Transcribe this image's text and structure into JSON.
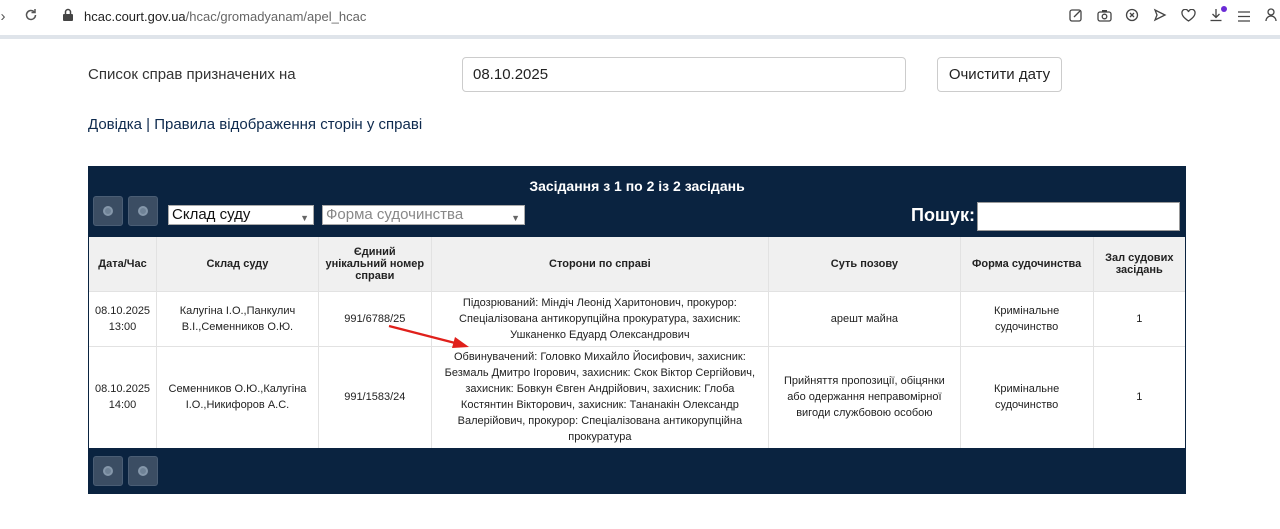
{
  "browser": {
    "url_host": "hcac.court.gov.ua",
    "url_path": "/hcac/gromadyanam/apel_hcac"
  },
  "header": {
    "list_label": "Список справ призначених на",
    "date_value": "08.10.2025",
    "clear_button": "Очистити дату",
    "link_help": "Довідка",
    "link_separator": "|",
    "link_rules": "Правила відображення сторін у справі"
  },
  "panel": {
    "title": "Засідання з 1 по 2 із 2 засідань",
    "select_court": "Склад суду",
    "select_form": "Форма судочинства",
    "search_label": "Пошук:",
    "search_value": ""
  },
  "table": {
    "headers": {
      "date": "Дата/Час",
      "court": "Склад суду",
      "number": "Єдиний унікальний номер справи",
      "parties": "Сторони по справі",
      "essence": "Суть позову",
      "form": "Форма судочинства",
      "hall": "Зал судових засідань"
    },
    "rows": [
      {
        "date": "08.10.2025 13:00",
        "court": "Калугіна І.О.,Панкулич В.І.,Семенников О.Ю.",
        "number": "991/6788/25",
        "parties": "Підозрюваний: Міндіч Леонід Харитонович, прокурор: Спеціалізована антикорупційна прокуратура, захисник: Ушканенко Едуард Олександрович",
        "essence": "арешт майна",
        "form": "Кримінальне судочинство",
        "hall": "1"
      },
      {
        "date": "08.10.2025 14:00",
        "court": "Семенников О.Ю.,Калугіна І.О.,Никифоров А.С.",
        "number": "991/1583/24",
        "parties": "Обвинувачений: Головко Михайло Йосифович, захисник: Безмаль Дмитро Ігорович, захисник: Скок Віктор Сергійович, захисник: Бовкун Євген Андрійович, захисник: Глоба Костянтин Вікторович, захисник: Тананакін Олександр Валерійович, прокурор: Спеціалізована антикорупційна прокуратура",
        "essence": "Прийняття пропозиції, обіцянки або одержання неправомірної вигоди службовою особою",
        "form": "Кримінальне судочинство",
        "hall": "1"
      }
    ]
  },
  "colors": {
    "panel_bg": "#0a2340",
    "annotation_arrow": "#e0201b"
  },
  "icons": [
    "chevron-right-icon",
    "reload-icon",
    "lock-icon",
    "edit-icon",
    "camera-icon",
    "shield-icon",
    "send-icon",
    "heart-icon",
    "download-icon",
    "menu-icon",
    "user-icon"
  ]
}
